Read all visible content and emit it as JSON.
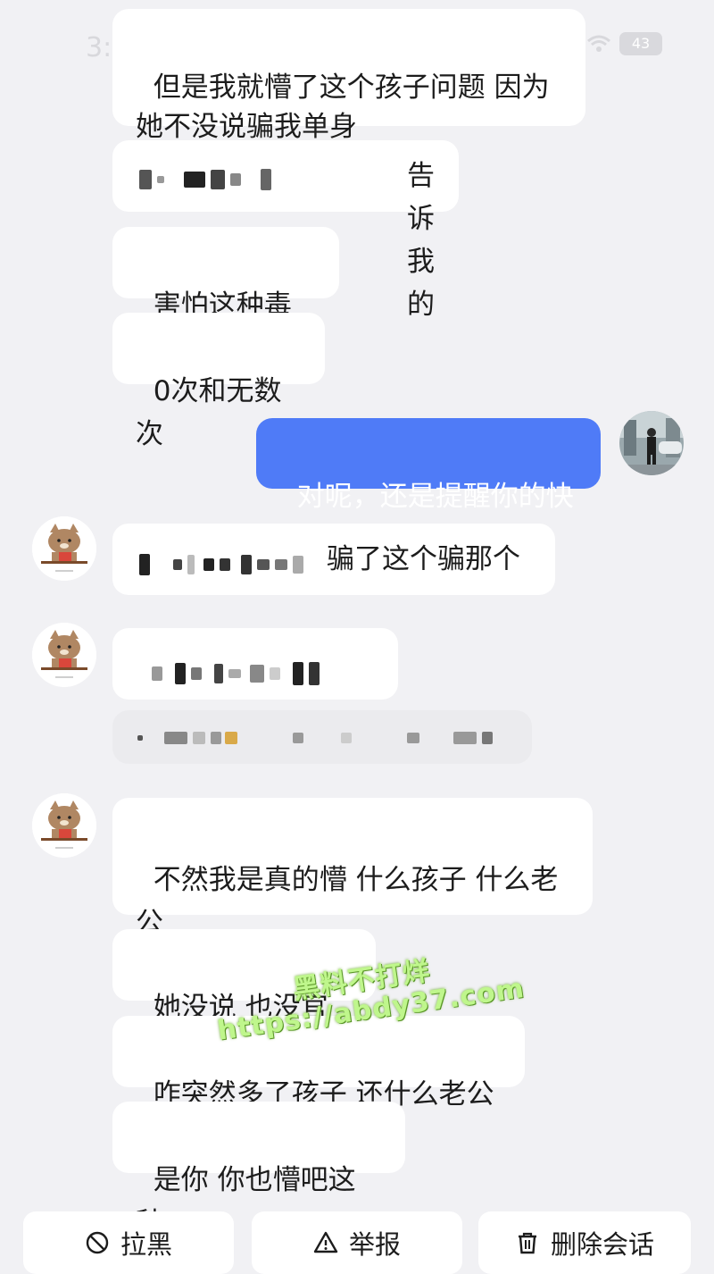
{
  "status_bar": {
    "time": "3:",
    "battery": "43"
  },
  "messages": [
    {
      "text": "但是我就懵了这个孩子问题 因为\n她不没说骗我单身"
    },
    {
      "text": "告诉我的"
    },
    {
      "text": "害怕这种毒妇"
    },
    {
      "text": "0次和无数次"
    },
    {
      "text": "对呢，还是提醒你的快"
    },
    {
      "text": "骗了这个骗那个"
    },
    {
      "text": "不然我是真的懵 什么孩子 什么老\n公"
    },
    {
      "text": "她没说 也没官宣"
    },
    {
      "text": "咋突然多了孩子 还什么老公"
    },
    {
      "text": "是你 你也懵吧这种"
    }
  ],
  "watermark": {
    "line1": "黑料不打烊",
    "line2": "https://abdy37.com"
  },
  "actions": {
    "block": "拉黑",
    "report": "举报",
    "delete": "删除会话"
  },
  "icons": {
    "block": "block-icon",
    "report": "warning-icon",
    "delete": "trash-icon",
    "cat_avatar": "cat-avatar",
    "user_avatar": "photo-avatar"
  },
  "colors": {
    "background": "#f1f1f4",
    "bubble": "#ffffff",
    "mine_bubble": "#4f7bf7",
    "watermark": "#bff68c"
  }
}
